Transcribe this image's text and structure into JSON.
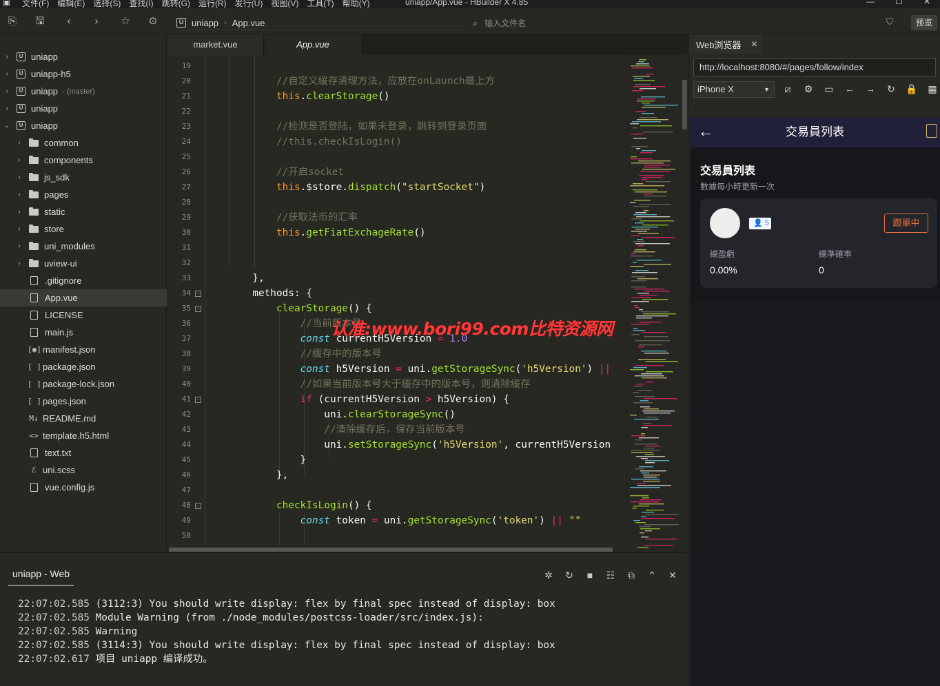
{
  "window": {
    "title": "uniapp/App.vue - HBuilder X 4.85",
    "menus": [
      "文件(F)",
      "编辑(E)",
      "选择(S)",
      "查找(I)",
      "跳转(G)",
      "运行(R)",
      "发行(U)",
      "视图(V)",
      "工具(T)",
      "帮助(Y)"
    ]
  },
  "toolbar": {
    "breadcrumb": [
      "uniapp",
      "App.vue"
    ],
    "file_search_placeholder": "输入文件名",
    "preview_label": "预览"
  },
  "project_tree": [
    {
      "label": "uniapp",
      "type": "project",
      "expanded": false
    },
    {
      "label": "uniapp-h5",
      "type": "project",
      "expanded": false
    },
    {
      "label": "uniapp",
      "type": "project",
      "expanded": false,
      "branch": "(master)"
    },
    {
      "label": "uniapp",
      "type": "project",
      "expanded": false
    },
    {
      "label": "uniapp",
      "type": "project",
      "expanded": true
    },
    {
      "label": "common",
      "type": "folder"
    },
    {
      "label": "components",
      "type": "folder"
    },
    {
      "label": "js_sdk",
      "type": "folder"
    },
    {
      "label": "pages",
      "type": "folder"
    },
    {
      "label": "static",
      "type": "folder"
    },
    {
      "label": "store",
      "type": "folder"
    },
    {
      "label": "uni_modules",
      "type": "folder"
    },
    {
      "label": "uview-ui",
      "type": "folder"
    },
    {
      "label": ".gitignore",
      "type": "file"
    },
    {
      "label": "App.vue",
      "type": "vue",
      "selected": true
    },
    {
      "label": "LICENSE",
      "type": "file"
    },
    {
      "label": "main.js",
      "type": "file"
    },
    {
      "label": "manifest.json",
      "type": "manifest"
    },
    {
      "label": "package.json",
      "type": "json"
    },
    {
      "label": "package-lock.json",
      "type": "json"
    },
    {
      "label": "pages.json",
      "type": "json"
    },
    {
      "label": "README.md",
      "type": "md"
    },
    {
      "label": "template.h5.html",
      "type": "html"
    },
    {
      "label": "text.txt",
      "type": "file"
    },
    {
      "label": "uni.scss",
      "type": "scss"
    },
    {
      "label": "vue.config.js",
      "type": "file"
    }
  ],
  "editor_tabs": [
    "market.vue",
    "App.vue"
  ],
  "editor": {
    "line_numbers": [
      "19",
      "20",
      "21",
      "22",
      "23",
      "24",
      "25",
      "26",
      "27",
      "28",
      "29",
      "30",
      "31",
      "32",
      "33",
      "34",
      "35",
      "36",
      "37",
      "38",
      "39",
      "40",
      "41",
      "42",
      "43",
      "44",
      "45",
      "46",
      "47",
      "48",
      "49",
      "50"
    ],
    "folded_lines": [
      "34",
      "35",
      "41",
      "48"
    ]
  },
  "watermark": "认准:www.bori99.com比特资源网",
  "console": {
    "tab_label": "uniapp - Web",
    "lines": [
      {
        "time": "22:07:02.585",
        "text": "(3112:3) You should write display: flex by final spec instead of display: box"
      },
      {
        "time": "22:07:02.585",
        "text": "Module Warning (from ./node_modules/postcss-loader/src/index.js):"
      },
      {
        "time": "22:07:02.585",
        "text": "Warning"
      },
      {
        "time": "22:07:02.585",
        "text": "(3114:3) You should write display: flex by final spec instead of display: box"
      },
      {
        "time": "22:07:02.617",
        "text": "项目 uniapp 编译成功。"
      }
    ]
  },
  "browser": {
    "tab_label": "Web浏览器",
    "url": "http://localhost:8080/#/pages/follow/index",
    "device": "iPhone X",
    "phone": {
      "nav_title": "交易員列表",
      "heading": "交易員列表",
      "subheading": "數據每小時更新一次",
      "trader": {
        "followers": "5",
        "follow_label": "跟單中",
        "pnl_label": "總盈虧",
        "pnl_value": "0.00%",
        "rate_label": "總準確率",
        "rate_value": "0"
      }
    }
  },
  "colors": {
    "editor_bg": "#272822",
    "comment": "#75715e",
    "keyword": "#f92672",
    "function": "#a6e22e",
    "string": "#e6db74",
    "number": "#ae81ff",
    "phone_nav_bg": "#202038",
    "follow_accent": "#e8703a",
    "watermark": "#ff3a3a"
  }
}
